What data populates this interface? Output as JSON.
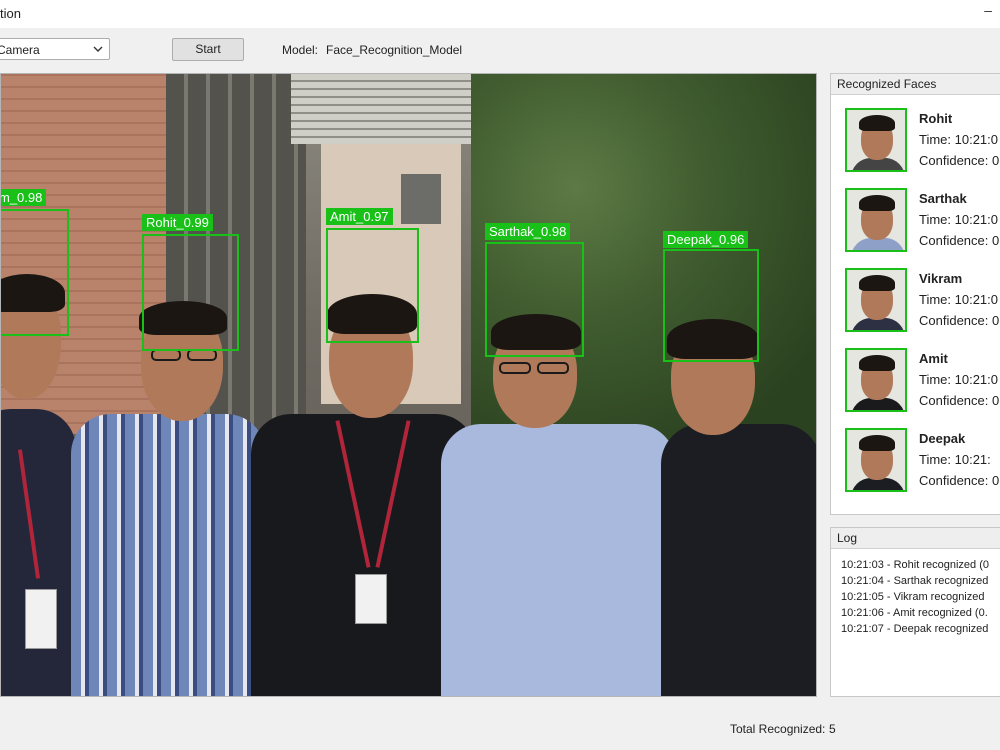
{
  "window": {
    "title": "tion"
  },
  "toolbar": {
    "source_value": "Camera",
    "start_label": "Start",
    "model_label": "Model:",
    "model_value": "Face_Recognition_Model"
  },
  "detections": [
    {
      "label": "m_0.98"
    },
    {
      "label": "Rohit_0.99"
    },
    {
      "label": "Amit_0.97"
    },
    {
      "label": "Sarthak_0.98"
    },
    {
      "label": "Deepak_0.96"
    }
  ],
  "recognized": {
    "header": "Recognized Faces",
    "items": [
      {
        "name": "Rohit",
        "time": "Time: 10:21:0",
        "confidence": "Confidence: 0"
      },
      {
        "name": "Sarthak",
        "time": "Time: 10:21:0",
        "confidence": "Confidence: 0"
      },
      {
        "name": "Vikram",
        "time": "Time: 10:21:0",
        "confidence": "Confidence: 0"
      },
      {
        "name": "Amit",
        "time": "Time: 10:21:0",
        "confidence": "Confidence: 0"
      },
      {
        "name": "Deepak",
        "time": "Time: 10:21:",
        "confidence": "Confidence: 0"
      }
    ]
  },
  "log": {
    "header": "Log",
    "lines": [
      "10:21:03 - Rohit recognized (0",
      "10:21:04 - Sarthak recognized",
      "10:21:05 - Vikram recognized",
      "10:21:06 - Amit recognized (0.",
      "10:21:07 - Deepak recognized"
    ]
  },
  "status": {
    "total_label": "Total Recognized:",
    "total_value": "5"
  },
  "colors": {
    "detection_green": "#18c018",
    "window_bg": "#f0f0f0"
  }
}
